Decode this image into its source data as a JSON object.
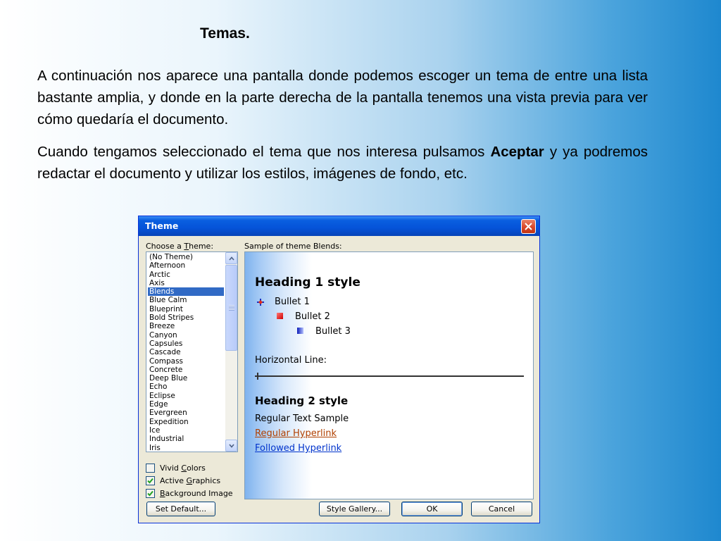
{
  "slide": {
    "title": "Temas.",
    "paragraph1": "A continuación nos aparece una pantalla donde podemos escoger un tema de entre una lista bastante amplia, y donde en la parte derecha de la pantalla tenemos una vista previa para ver cómo quedaría el documento.",
    "paragraph2_before": "Cuando tengamos seleccionado el tema que nos interesa pulsamos ",
    "paragraph2_bold": "Aceptar",
    "paragraph2_after": " y ya podremos redactar el documento y utilizar los estilos, imágenes de fondo, etc."
  },
  "dialog": {
    "title": "Theme",
    "choose_label_pre": "Choose a ",
    "choose_label_accel": "T",
    "choose_label_post": "heme:",
    "sample_label": "Sample of theme Blends:",
    "themes": [
      "(No Theme)",
      "Afternoon",
      "Arctic",
      "Axis",
      "Blends",
      "Blue Calm",
      "Blueprint",
      "Bold Stripes",
      "Breeze",
      "Canyon",
      "Capsules",
      "Cascade",
      "Compass",
      "Concrete",
      "Deep Blue",
      "Echo",
      "Eclipse",
      "Edge",
      "Evergreen",
      "Expedition",
      "Ice",
      "Industrial",
      "Iris"
    ],
    "selected_theme": "Blends",
    "checkboxes": [
      {
        "pre": "Vivid ",
        "accel": "C",
        "post": "olors",
        "checked": false
      },
      {
        "pre": "Active ",
        "accel": "G",
        "post": "raphics",
        "checked": true
      },
      {
        "pre": "",
        "accel": "B",
        "post": "ackground Image",
        "checked": true
      }
    ],
    "preview": {
      "heading1": "Heading 1 style",
      "bullet1": "Bullet 1",
      "bullet2": "Bullet 2",
      "bullet3": "Bullet 3",
      "horizontal_line": "Horizontal Line:",
      "heading2": "Heading 2 style",
      "regular_text": "Regular Text Sample",
      "regular_hyperlink": "Regular Hyperlink",
      "followed_hyperlink": "Followed Hyperlink"
    },
    "buttons": {
      "set_default": "Set Default...",
      "style_gallery": "Style Gallery...",
      "ok": "OK",
      "cancel": "Cancel"
    }
  }
}
